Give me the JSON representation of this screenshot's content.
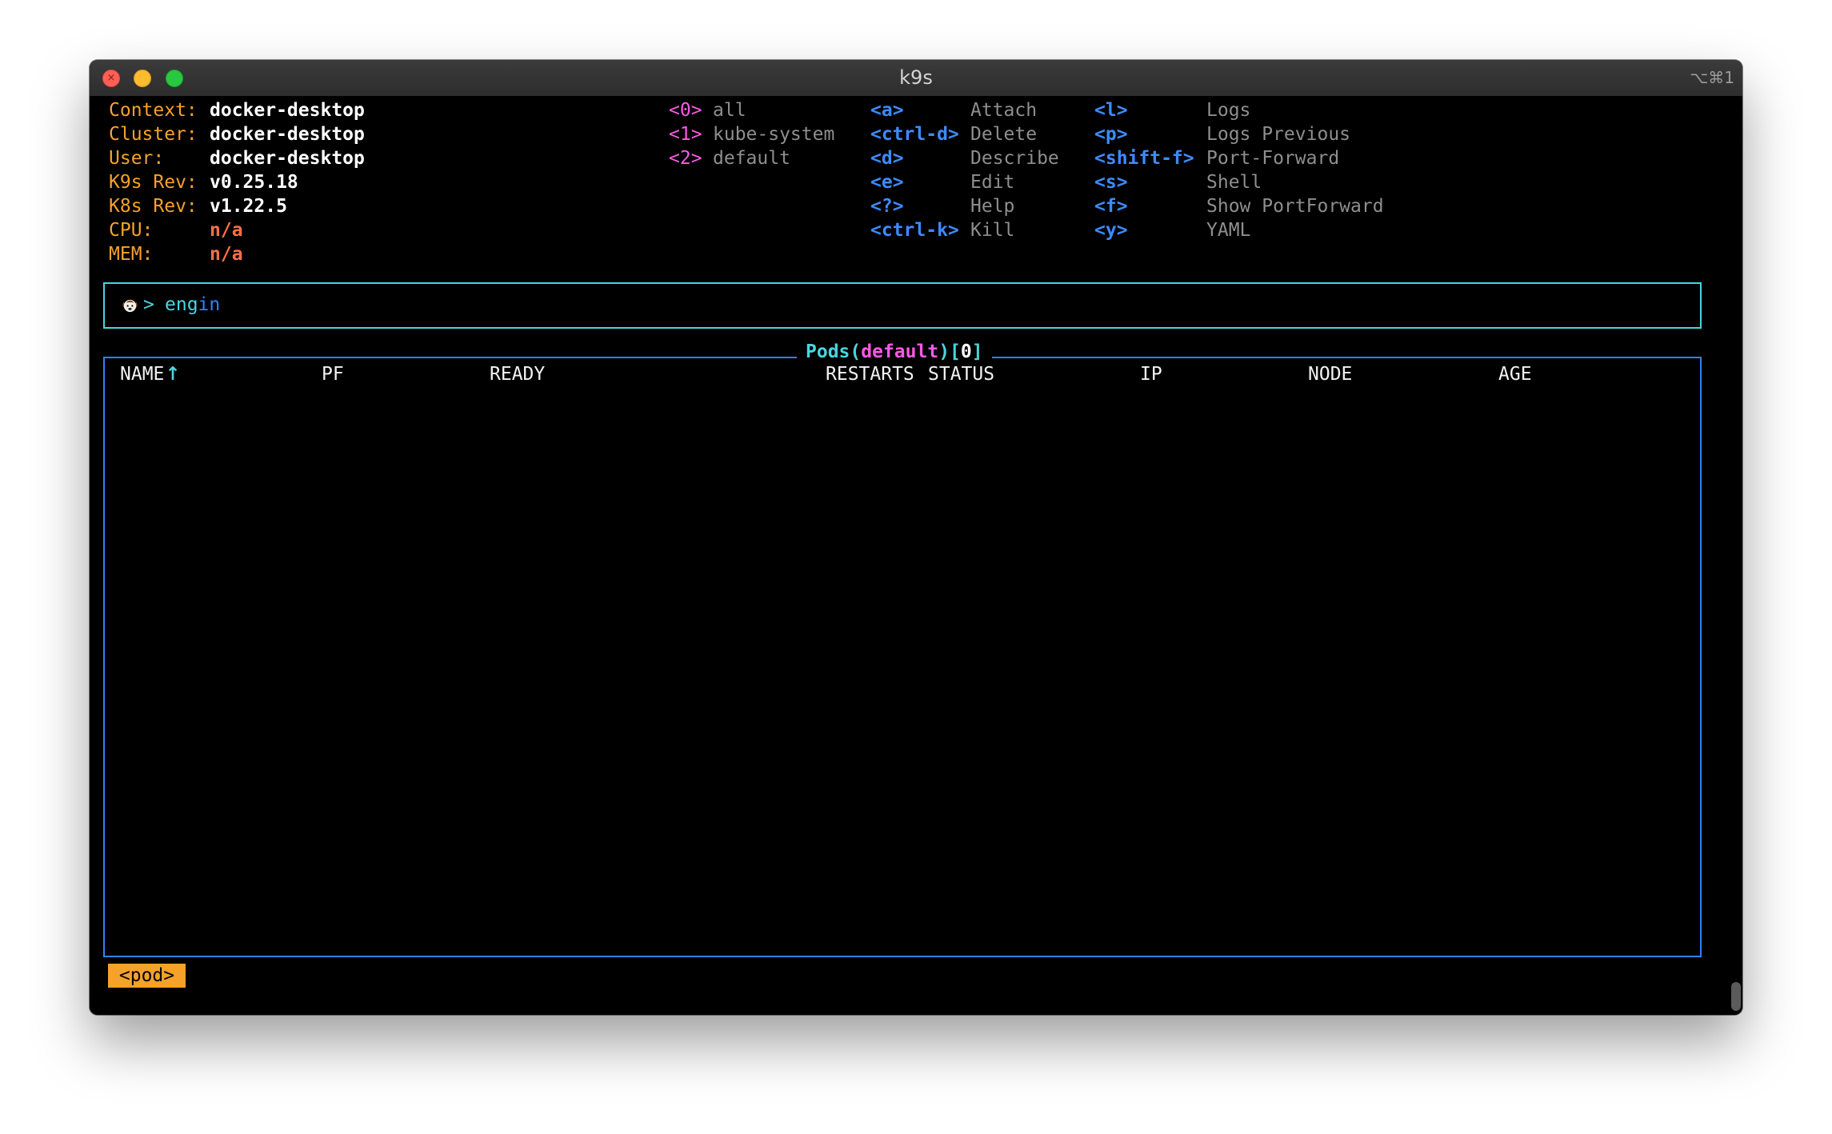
{
  "window": {
    "title": "k9s",
    "shortcut": "⌥⌘1",
    "close_symbol": "×"
  },
  "cluster_info": [
    {
      "label": "Context:",
      "value": "docker-desktop"
    },
    {
      "label": "Cluster:",
      "value": "docker-desktop"
    },
    {
      "label": "User:",
      "value": "docker-desktop"
    },
    {
      "label": "K9s Rev:",
      "value": "v0.25.18"
    },
    {
      "label": "K8s Rev:",
      "value": "v1.22.5"
    },
    {
      "label": "CPU:",
      "value": "n/a"
    },
    {
      "label": "MEM:",
      "value": "n/a"
    }
  ],
  "namespaces": [
    {
      "key": "<0>",
      "value": "all"
    },
    {
      "key": "<1>",
      "value": "kube-system"
    },
    {
      "key": "<2>",
      "value": "default"
    }
  ],
  "actions_left": [
    {
      "key": "<a>",
      "value": "Attach"
    },
    {
      "key": "<ctrl-d>",
      "value": "Delete"
    },
    {
      "key": "<d>",
      "value": "Describe"
    },
    {
      "key": "<e>",
      "value": "Edit"
    },
    {
      "key": "<?>",
      "value": "Help"
    },
    {
      "key": "<ctrl-k>",
      "value": "Kill"
    }
  ],
  "actions_right": [
    {
      "key": "<l>",
      "value": "Logs"
    },
    {
      "key": "<p>",
      "value": "Logs Previous"
    },
    {
      "key": "<shift-f>",
      "value": "Port-Forward"
    },
    {
      "key": "<s>",
      "value": "Shell"
    },
    {
      "key": "<f>",
      "value": "Show PortForward"
    },
    {
      "key": "<y>",
      "value": "YAML"
    }
  ],
  "command": {
    "prompt": ">",
    "typed": "eng",
    "suggestion": "in"
  },
  "pods": {
    "resource": "Pods",
    "open_paren": "(",
    "namespace": "default",
    "close_paren": ")",
    "open_bracket": "[",
    "count": "0",
    "close_bracket": "]",
    "columns": [
      "NAME",
      "PF",
      "READY",
      "RESTARTS",
      "STATUS",
      "IP",
      "NODE",
      "AGE"
    ],
    "sort_indicator": "↑",
    "rows": []
  },
  "footer": {
    "crumb": "<pod>"
  },
  "colors": {
    "orange": "#f6a229",
    "cyan": "#48d6df",
    "blue": "#2f82ff",
    "magenta": "#ff58e6",
    "white": "#ffffff",
    "gray": "#8e8e8e",
    "warning": "#ff6f45"
  }
}
